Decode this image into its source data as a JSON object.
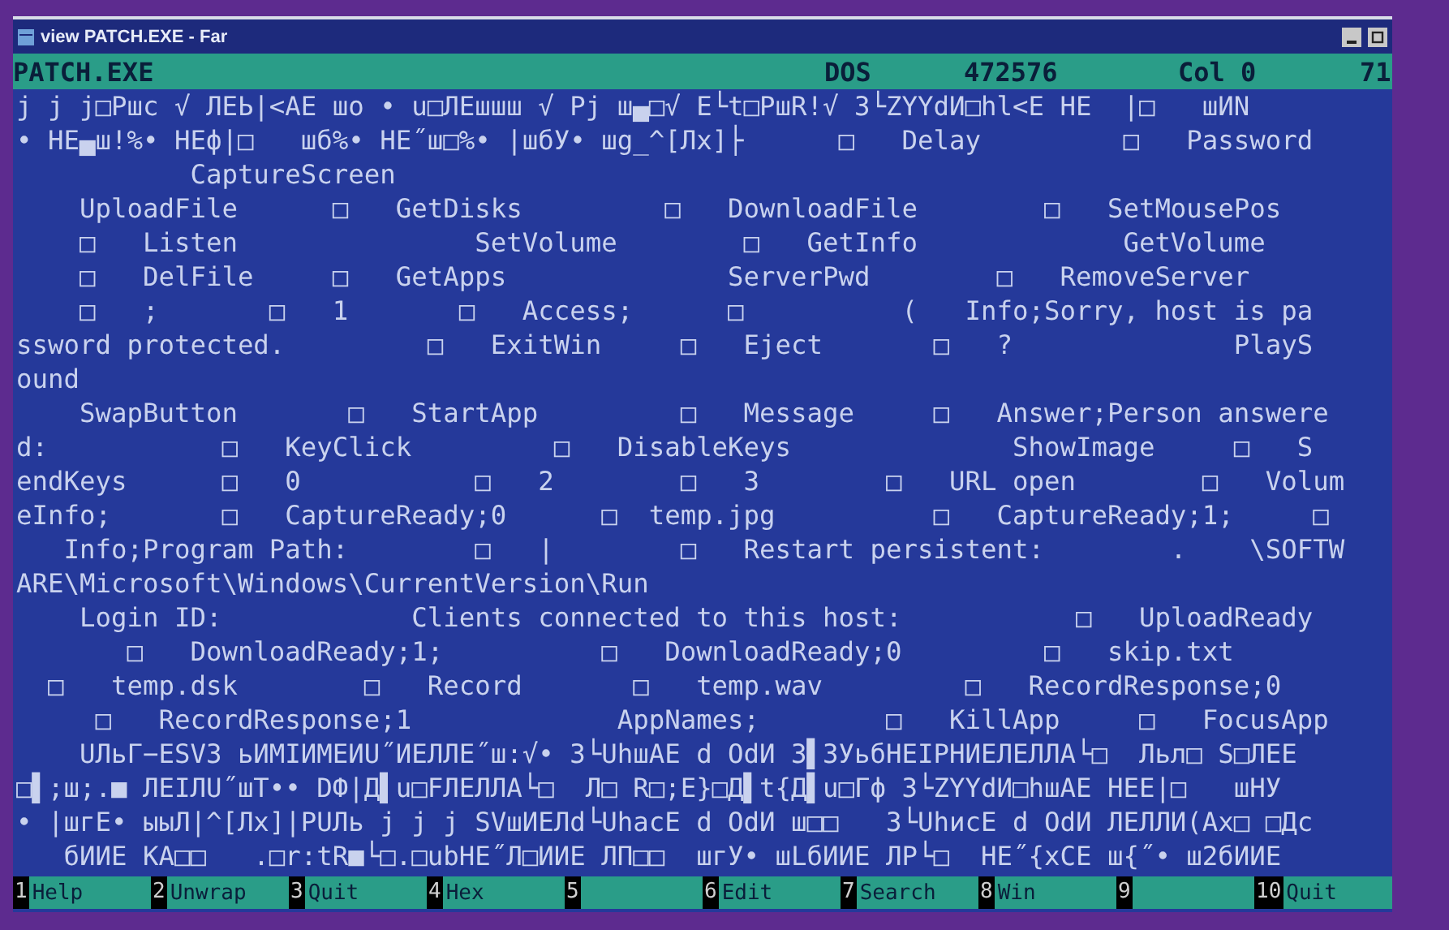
{
  "window": {
    "title": "view PATCH.EXE - Far"
  },
  "status_bar": {
    "file": "PATCH.EXE",
    "encoding": "DOS",
    "size": "472576",
    "column": "Col 0",
    "percent": "71"
  },
  "lines": [
    "j j j□Pшc √ ЛЕЬ|<AE шо • u□ЛЕшшш √ Pj ш▄□√ E└t□PшR!√ 3└ZYYdИ□hl<E HE  |□   шИN",
    "• HE▄ш!%• HEф|□   шб%• HE˝ш□%• |шбУ• шg_^[Лx]├      □   Delay         □   Password",
    "           CaptureScreen",
    "    UploadFile      □   GetDisks         □   DownloadFile        □   SetMousePos",
    "    □   Listen               SetVolume        □   GetInfo             GetVolume",
    "    □   DelFile     □   GetApps              ServerPwd        □   RemoveServer",
    "    □   ;       □   1       □   Access;      □          (   Info;Sorry, host is pa",
    "ssword protected.         □   ExitWin     □   Eject       □   ?              PlayS",
    "ound",
    "    SwapButton       □   StartApp         □   Message     □   Answer;Person answere",
    "d:           □   KeyClick         □   DisableKeys              ShowImage     □   S",
    "endKeys      □   0           □   2        □   3        □   URL open        □   Volum",
    "eInfo;       □   CaptureReady;0      □  temp.jpg          □   CaptureReady;1;     □",
    "   Info;Program Path:        □   |        □   Restart persistent:        .    \\SOFTW",
    "ARE\\Microsoft\\Windows\\CurrentVersion\\Run",
    "    Login ID:            Clients connected to this host:           □   UploadReady",
    "       □   DownloadReady;1;          □   DownloadReady;0         □   skip.txt",
    "  □   temp.dsk        □   Record       □   temp.wav         □   RecordResponse;0",
    "     □   RecordResponse;1             AppNames;        □   KillApp     □   FocusApp",
    "    UЛьГ−ESV3 ьИМIИМЕИU˝ИЕЛЛЕ˝ш:√• 3└UhшAE d OdИ 3▌3УьбНЕIРНИЕЛЕЛЛА└□  Льл□ S□ЛЕЕ",
    "□▌;ш;.■ ЛЕIЛU˝шТ•• DФ|Д▌u□FЛЕЛЛА└□  Л□ R□;E}□Д▌t{Д▌u□Гф 3└ZYYdИ□hшAE HEE|□   шHУ",
    "• |шгЕ• ыыЛ|^[Лx]|РUЛь j j j SVшИЕЛd└UhacE d OdИ ш□□   3└UhиcE d OdИ ЛЕЛЛИ(Ax□ □Дс",
    "   бИИЕ KA□□   .□r:tR■└□.□ubHE˝Л□ИИЕ ЛП□□  шгУ• шLбИИЕ ЛР└□  HE˝{xCE ш{˝• ш2бИИЕ"
  ],
  "keybar": [
    {
      "number": "1",
      "label": "Help"
    },
    {
      "number": "2",
      "label": "Unwrap"
    },
    {
      "number": "3",
      "label": "Quit"
    },
    {
      "number": "4",
      "label": "Hex"
    },
    {
      "number": "5"
    },
    {
      "number": "6",
      "label": "Edit"
    },
    {
      "number": "7",
      "label": "Search"
    },
    {
      "number": "8",
      "label": "Win"
    },
    {
      "number": "9"
    },
    {
      "number": "10",
      "label": "Quit"
    }
  ]
}
